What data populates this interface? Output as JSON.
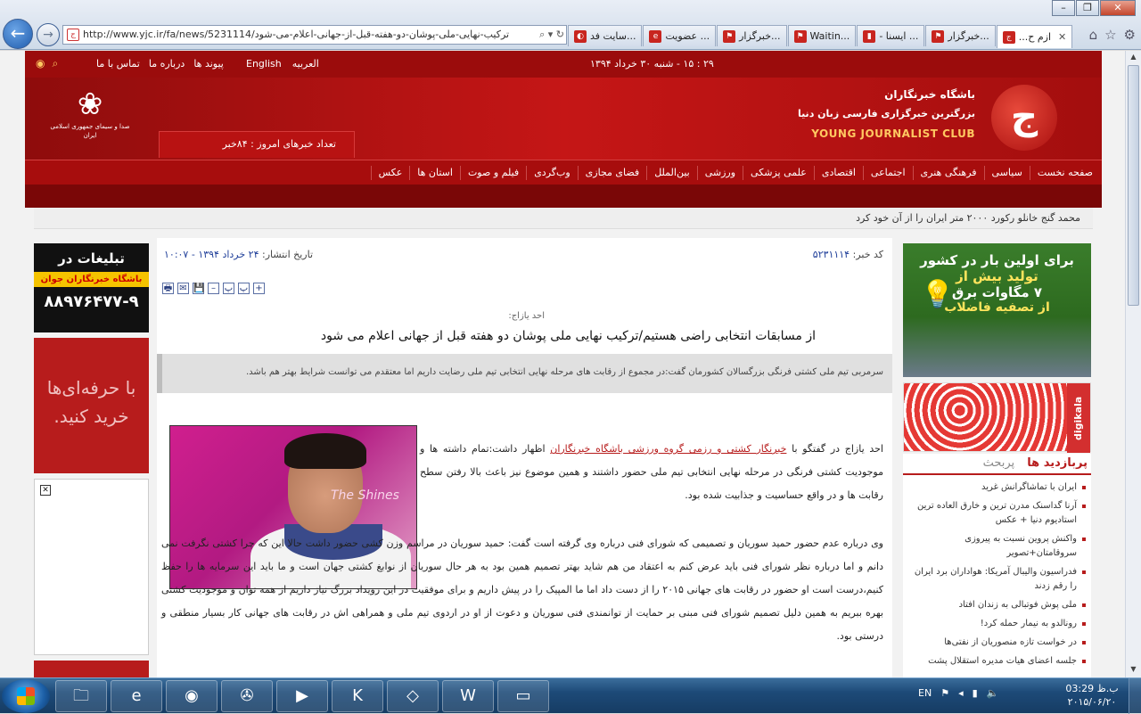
{
  "browser": {
    "window_controls": [
      "–",
      "❐",
      "✕"
    ],
    "address": "http://www.yjc.ir/fa/news/5231114/ترکیب-نهایی-ملی-پوشان-دو-هفته-قبل-از-جهانی-اعلام-می-شود",
    "address_tools": "⌕ ▾ ↻",
    "tabs": [
      {
        "label": "سایت فد...",
        "fav": "◐"
      },
      {
        "label": "عضویت ...",
        "fav": "e"
      },
      {
        "label": "خبرگزار...",
        "fav": "⚑"
      },
      {
        "label": "Waitin...",
        "fav": "⚑"
      },
      {
        "label": "- ایسنا ...",
        "fav": "▮"
      },
      {
        "label": "خبرگزار...",
        "fav": "⚑"
      },
      {
        "label": "...ازم ح",
        "fav": "ج",
        "active": true
      }
    ],
    "tab_close": "✕",
    "right_tools": [
      "⌂",
      "☆",
      "⚙"
    ]
  },
  "site": {
    "topbar": {
      "date": "۲۹ : ۱۵ - شنبه ۳۰ خرداد ۱۳۹۴",
      "links": [
        "تماس با ما",
        "درباره ما",
        "پیوند ها"
      ],
      "langs": [
        "English",
        "العربیه"
      ],
      "icons": [
        "rss-icon",
        "search-icon"
      ]
    },
    "header": {
      "tv_caption": "صدا و سیمای جمهوری اسلامی ایران",
      "news_count": "تعداد خبرهای امروز : ۸۴خبر",
      "brand_fa_1": "باشگاه خبرنگاران",
      "brand_fa_2": "بزرگترین خبرگزاری فارسی زبان دنیا",
      "brand_en": "YOUNG JOURNALIST CLUB",
      "brand_logo": "ج"
    },
    "menu": [
      "صفحه نخست",
      "سیاسی",
      "فرهنگی هنری",
      "اجتماعی",
      "اقتصادی",
      "علمی پزشکی",
      "ورزشی",
      "بین‌الملل",
      "فضای مجازی",
      "وب‌گردی",
      "فیلم و صوت",
      "استان ها",
      "عکس"
    ],
    "ticker": "محمد گنج خانلو رکورد ۲۰۰۰ متر ایران را از آن خود کرد",
    "left_ads": {
      "ad1_title": "تبلیغات در",
      "ad1_name": "باشگاه خبرنگاران جوان",
      "ad1_phone": "۸۸۹۷۶۴۷۷-۹",
      "ad2_text": "با حرفه‌ای‌ها خرید کنید."
    },
    "article": {
      "code_label": "کد خبر:",
      "code": "۵۲۳۱۱۱۴",
      "date_label": "تاریخ انتشار:",
      "date": "۲۴ خرداد ۱۳۹۴ - ۱۰:۰۷",
      "tools": [
        "+",
        "پ",
        "پ",
        "–",
        "💾",
        "✉",
        "🖶"
      ],
      "author": "احد یازاج:",
      "headline": "از مسابقات انتخابی راضی هستیم/ترکیب نهایی ملی پوشان دو هفته قبل از جهانی اعلام می شود",
      "lead": "سرمربی تیم ملی کشتی فرنگی بزرگسالان کشورمان گفت:در مجموع از رقابت های مرحله نهایی انتخابی تیم ملی رضایت داریم اما معتقدم می توانست شرایط بهتر هم باشد.",
      "photo_text": "The Shines",
      "para1_before": "احد یازاج در گفتگو با",
      "para1_link": "خبرنگار کشتی و رزمی گروه ورزشی باشگاه خبرنگاران",
      "para1_after": "اظهار داشت:تمام داشته ها و موجودیت کشتی فرنگی در مرحله نهایی انتخابی تیم ملی حضور داشتند و همین موضوع نیز باعث بالا رفتن سطح رقابت ها و در واقع حساسیت و جذابیت شده بود.",
      "para2": "وی درباره عدم حضور حمید سوریان و تصمیمی که شورای فنی درباره وی گرفته است گفت: حمید سوریان در مراسم وزن کشی حضور داشت حالا این که چرا کشتی نگرفت نمی دانم و اما درباره نظر شورای فنی باید عرض کنم به اعتقاد من هم شاید بهتر تصمیم همین بود به هر حال سوریان از نوابغ کشتی جهان است و ما باید این سرمایه ها را حفظ کنیم،درست است او حضور در رقابت های جهانی ۲۰۱۵ را از دست داد اما ما المپیک را در پیش داریم و برای موفقیت در این رویداد بزرگ نیاز داریم از همه توان و موجودیت کشتی بهره ببریم به همین دلیل تصمیم شورای فنی مبنی بر حمایت از توانمندی فنی سوریان و دعوت از او در اردوی تیم ملی و همراهی اش در رقابت های جهانی کار بسیار منطقی و درستی بود."
    },
    "right_ads": {
      "ad1_l1": "برای اولین بار در کشور",
      "ad1_l2": "تولید بیش از",
      "ad1_l3": "۷ مگاوات برق",
      "ad1_l4": "از تصفیه فاضلاب",
      "ad2_brand": "digikala"
    },
    "popular": {
      "tab_active": "پربازدید ها",
      "tab_other": "پربحث",
      "items": [
        "ایران با تماشاگرانش غرید",
        "آرنا گداسنک مدرن ترین و خارق العاده ترین استادیوم دنیا + عکس",
        "واکنش پروین نسبت به پیروزی سروقامتان+تصویر",
        "فدراسیون والیبال آمریکا: هواداران برد ایران را رقم زدند",
        "ملی پوش فوتبالی به زندان افتاد",
        "رونالدو به نیمار حمله کرد!",
        "در خواست تازه منصوریان از نفتی‌ها",
        "جلسه اعضای هیات مدیره استقلال پشت"
      ]
    }
  },
  "taskbar": {
    "apps": [
      "🗀",
      "e",
      "◉",
      "✇",
      "▶",
      "K",
      "◇",
      "W",
      "▭"
    ],
    "lang": "EN",
    "tray_icons": [
      "⚑",
      "◂",
      "▮",
      "🔈"
    ],
    "clock_time": "03:29 ب.ظ",
    "clock_date": "۲۰۱۵/۰۶/۲۰"
  }
}
